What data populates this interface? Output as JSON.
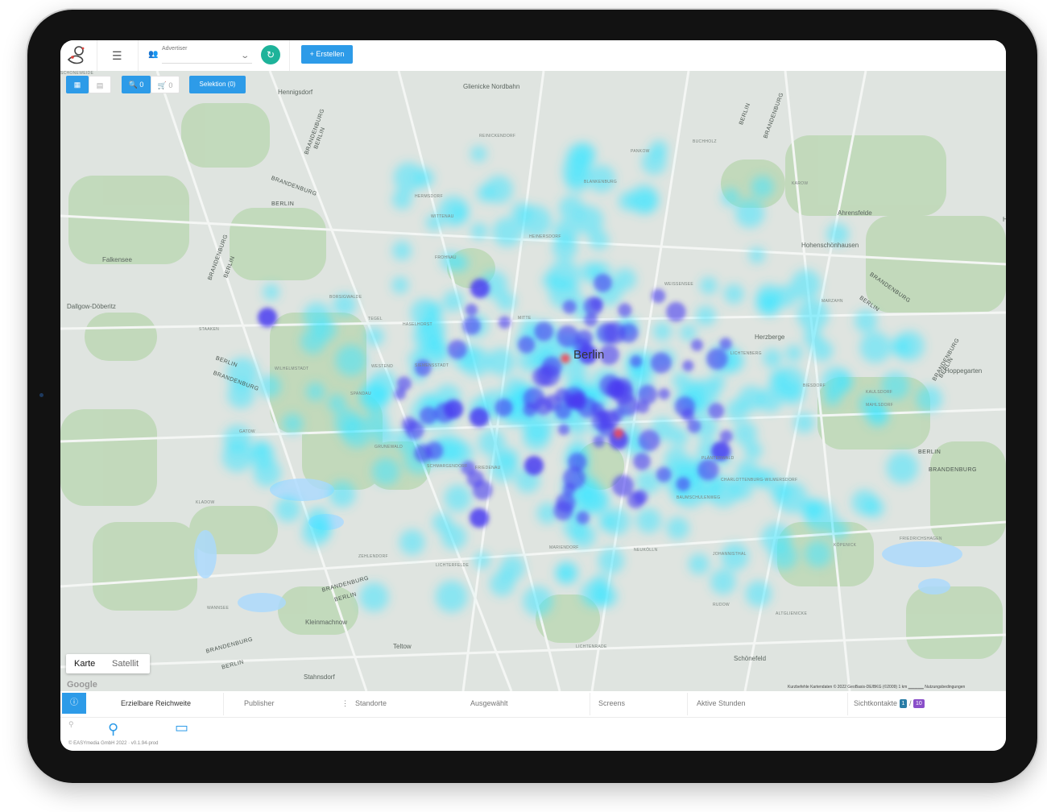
{
  "topbar": {
    "advertiser_label": "Advertiser",
    "create_label": "+ Erstellen"
  },
  "map_controls": {
    "search_count": "0",
    "cart_count": "0",
    "selection_label": "Selektion (0)"
  },
  "map": {
    "city": "Berlin",
    "labels": [
      {
        "t": "Hennigsdorf",
        "c": "mid"
      },
      {
        "t": "Glienicke Nordbahn",
        "c": "mid"
      },
      {
        "t": "Falkensee",
        "c": "mid"
      },
      {
        "t": "Dallgow-Döberitz",
        "c": "mid"
      },
      {
        "t": "Ahrensfelde",
        "c": "mid"
      },
      {
        "t": "Hönow",
        "c": "mid"
      },
      {
        "t": "Hohenschönhausen",
        "c": "mid"
      },
      {
        "t": "Herzberge",
        "c": "mid"
      },
      {
        "t": "Hoppegarten",
        "c": "mid"
      },
      {
        "t": "Kleinmachnow",
        "c": "mid"
      },
      {
        "t": "Teltow",
        "c": "mid"
      },
      {
        "t": "Stahnsdorf",
        "c": "mid"
      },
      {
        "t": "Schönefeld",
        "c": "mid"
      },
      {
        "t": "MITTE",
        "c": "small"
      },
      {
        "t": "WESTEND",
        "c": "small"
      },
      {
        "t": "GRUNEWALD",
        "c": "small"
      },
      {
        "t": "SPANDAU",
        "c": "small"
      },
      {
        "t": "STAAKEN",
        "c": "small"
      },
      {
        "t": "WILHELMSTADT",
        "c": "small"
      },
      {
        "t": "GATOW",
        "c": "small"
      },
      {
        "t": "KLADOW",
        "c": "small"
      },
      {
        "t": "WANNSEE",
        "c": "small"
      },
      {
        "t": "ZEHLENDORF",
        "c": "small"
      },
      {
        "t": "FRIEDENAU",
        "c": "small"
      },
      {
        "t": "SCHMARGENDORF",
        "c": "small"
      },
      {
        "t": "LICHTERFELDE",
        "c": "small"
      },
      {
        "t": "MARIENDORF",
        "c": "small"
      },
      {
        "t": "LICHTENRADE",
        "c": "small"
      },
      {
        "t": "RUDOW",
        "c": "small"
      },
      {
        "t": "NEUKÖLLN",
        "c": "small"
      },
      {
        "t": "PLÄNTERWALD",
        "c": "small"
      },
      {
        "t": "BAUMSCHULENWEG",
        "c": "small"
      },
      {
        "t": "JOHANNISTHAL",
        "c": "small"
      },
      {
        "t": "ALTGLIENICKE",
        "c": "small"
      },
      {
        "t": "KÖPENICK",
        "c": "small"
      },
      {
        "t": "FRIEDRICHSHAGEN",
        "c": "small"
      },
      {
        "t": "LICHTENBERG",
        "c": "small"
      },
      {
        "t": "BIESDORF",
        "c": "small"
      },
      {
        "t": "KAULSDORF",
        "c": "small"
      },
      {
        "t": "MAHLSDORF",
        "c": "small"
      },
      {
        "t": "MARZAHN",
        "c": "small"
      },
      {
        "t": "WEISSENSEE",
        "c": "small"
      },
      {
        "t": "PANKOW",
        "c": "small"
      },
      {
        "t": "BUCHHOLZ",
        "c": "small"
      },
      {
        "t": "KAROW",
        "c": "small"
      },
      {
        "t": "BLANKENBURG",
        "c": "small"
      },
      {
        "t": "HEINERSDORF",
        "c": "small"
      },
      {
        "t": "REINICKENDORF",
        "c": "small"
      },
      {
        "t": "WITTENAU",
        "c": "small"
      },
      {
        "t": "HERMSDORF",
        "c": "small"
      },
      {
        "t": "FROHNAU",
        "c": "small"
      },
      {
        "t": "TEGEL",
        "c": "small"
      },
      {
        "t": "BORSIGWALDE",
        "c": "small"
      },
      {
        "t": "SIEMENSSTADT",
        "c": "small"
      },
      {
        "t": "HASELHORST",
        "c": "small"
      },
      {
        "t": "CHARLOTTENBURG-WILMERSDORF",
        "c": "small"
      },
      {
        "t": "SCHÖNEWEIDE",
        "c": "small"
      }
    ],
    "rotated_labels": [
      {
        "t": "BRANDENBURG"
      },
      {
        "t": "BERLIN"
      },
      {
        "t": "BRANDENBURG"
      },
      {
        "t": "BERLIN"
      },
      {
        "t": "BRANDENBURG"
      },
      {
        "t": "BERLIN"
      },
      {
        "t": "BERLIN"
      },
      {
        "t": "BRANDENBURG"
      },
      {
        "t": "BRANDENBURG"
      },
      {
        "t": "BERLIN"
      },
      {
        "t": "BERLIN"
      },
      {
        "t": "BRANDENBURG"
      },
      {
        "t": "BRANDENBURG"
      },
      {
        "t": "BERLIN"
      },
      {
        "t": "BERLIN"
      },
      {
        "t": "BRANDENBURG"
      },
      {
        "t": "BERLIN"
      },
      {
        "t": "BRANDENBURG"
      },
      {
        "t": "BRANDENBURG"
      },
      {
        "t": "BERLIN"
      }
    ],
    "map_type_map": "Karte",
    "map_type_satellite": "Satellit",
    "google": "Google",
    "attribution": "Kurzbefehle   Kartendaten © 2022 GeoBasis-DE/BKG (©2009)   1 km ▁▁▁▁▁   Nutzungsbedingungen",
    "colors": {
      "land": "#dfe4e0",
      "green": "#bfd8b8",
      "water": "#aadaff",
      "heat_low": "#43e6ff",
      "heat_mid": "#4a3cf0",
      "heat_high": "#f04a5a"
    }
  },
  "table": {
    "headers": {
      "reach": "Erzielbare Reichweite",
      "publisher": "Publisher",
      "locations": "Standorte",
      "selected": "Ausgewählt",
      "screens": "Screens",
      "active_hours": "Aktive Stunden",
      "contacts": "Sichtkontakte"
    },
    "badge_a": "1",
    "badge_b": "10"
  },
  "footer": {
    "copyright": "© EASYmedia GmbH 2022 · v0.1.94-prod"
  }
}
